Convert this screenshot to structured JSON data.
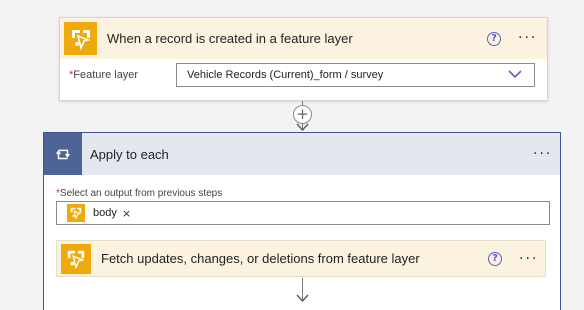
{
  "trigger": {
    "title": "When a record is created in a feature layer",
    "help_icon": "question-circle-icon",
    "more_icon": "ellipsis-icon",
    "field": {
      "required_mark": "*",
      "label": "Feature layer",
      "value": "Vehicle Records (Current)_form / survey"
    }
  },
  "connector": {
    "icon": "plus-icon"
  },
  "apply_to_each": {
    "title": "Apply to each",
    "icon": "loop-icon",
    "select_label_mark": "*",
    "select_label": "Select an output from previous steps",
    "token": {
      "label": "body",
      "remove": "×"
    },
    "inner_action": {
      "title": "Fetch updates, changes, or deletions from feature layer"
    }
  },
  "colors": {
    "connector_accent": "#f0a90a",
    "loop_header": "#4e6396",
    "header_tint": "#fbf3df",
    "help_blue": "#5b5fc7"
  }
}
